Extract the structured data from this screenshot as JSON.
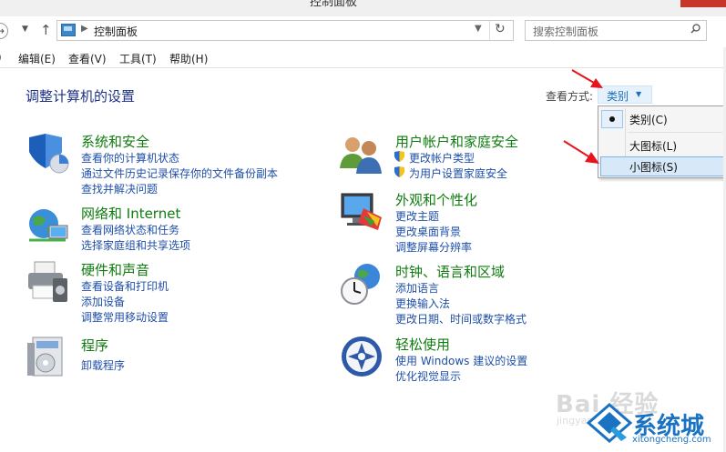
{
  "window": {
    "title": "控制面板"
  },
  "addressbar": {
    "path": "控制面板",
    "search_placeholder": "搜索控制面板",
    "forward_glyph": "→",
    "up_glyph": "↑",
    "refresh_glyph": "↻",
    "dropdown_glyph": "⌄"
  },
  "menubar": {
    "partial_left": ")",
    "items": [
      "编辑(E)",
      "查看(V)",
      "工具(T)",
      "帮助(H)"
    ]
  },
  "main": {
    "heading": "调整计算机的设置",
    "view_by_label": "查看方式:",
    "view_by_value": "类别",
    "view_menu": {
      "items": [
        "类别(C)",
        "大图标(L)",
        "小图标(S)"
      ],
      "checked_index": 0,
      "hover_index": 2
    },
    "categories": [
      {
        "title": "系统和安全",
        "icon": "system-security-icon",
        "links": [
          "查看你的计算机状态",
          "通过文件历史记录保存你的文件备份副本",
          "查找并解决问题"
        ]
      },
      {
        "title": "网络和 Internet",
        "icon": "network-internet-icon",
        "links": [
          "查看网络状态和任务",
          "选择家庭组和共享选项"
        ]
      },
      {
        "title": "硬件和声音",
        "icon": "hardware-sound-icon",
        "links": [
          "查看设备和打印机",
          "添加设备",
          "调整常用移动设置"
        ]
      },
      {
        "title": "程序",
        "icon": "programs-icon",
        "links": [
          "卸载程序"
        ]
      },
      {
        "title": "用户帐户和家庭安全",
        "icon": "user-accounts-icon",
        "links": [
          "更改帐户类型",
          "为用户设置家庭安全"
        ]
      },
      {
        "title": "外观和个性化",
        "icon": "appearance-icon",
        "links": [
          "更改主题",
          "更改桌面背景",
          "调整屏幕分辨率"
        ]
      },
      {
        "title": "时钟、语言和区域",
        "icon": "clock-language-icon",
        "links": [
          "添加语言",
          "更换输入法",
          "更改日期、时间或数字格式"
        ]
      },
      {
        "title": "轻松使用",
        "icon": "ease-of-access-icon",
        "links": [
          "使用 Windows 建议的设置",
          "优化视觉显示"
        ]
      }
    ]
  },
  "watermark": {
    "baidu": "Bai 经验",
    "jingyan": "jingyan",
    "site": "系统城",
    "domain": "xitongcheng.com"
  },
  "colors": {
    "link": "#1f4fa8",
    "category_title": "#0f7c0f",
    "heading": "#1e3287",
    "annotation_arrow": "#e8141b"
  }
}
